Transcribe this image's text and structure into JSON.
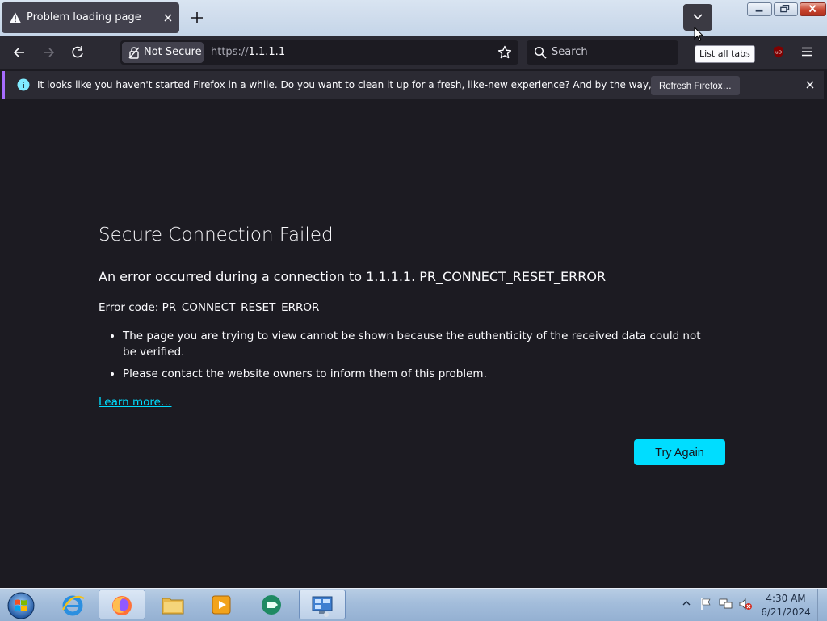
{
  "tab": {
    "title": "Problem loading page",
    "icon": "warning-icon"
  },
  "toolbar": {
    "not_secure_label": "Not Secure",
    "url_scheme": "https://",
    "url_host": "1.1.1.1",
    "search_placeholder": "Search",
    "tooltip": "List all tabs"
  },
  "notification": {
    "message": "It looks like you haven't started Firefox in a while. Do you want to clean it up for a fresh, like-new experience? And by the way, welcome back!",
    "button_label": "Refresh Firefox…"
  },
  "error": {
    "title": "Secure Connection Failed",
    "description": "An error occurred during a connection to 1.1.1.1. PR_CONNECT_RESET_ERROR",
    "code_line": "Error code: PR_CONNECT_RESET_ERROR",
    "bullets": [
      "The page you are trying to view cannot be shown because the authenticity of the received data could not be verified.",
      "Please contact the website owners to inform them of this problem."
    ],
    "learn_more": "Learn more…",
    "try_again": "Try Again"
  },
  "taskbar": {
    "items": [
      "internet-explorer-icon",
      "firefox-icon",
      "file-explorer-icon",
      "media-player-icon",
      "app-icon",
      "control-panel-icon"
    ],
    "time": "4:30 AM",
    "date": "6/21/2024"
  },
  "colors": {
    "accent": "#00ddff",
    "page_bg": "#1c1b22",
    "toolbar_bg": "#2b2a33"
  }
}
